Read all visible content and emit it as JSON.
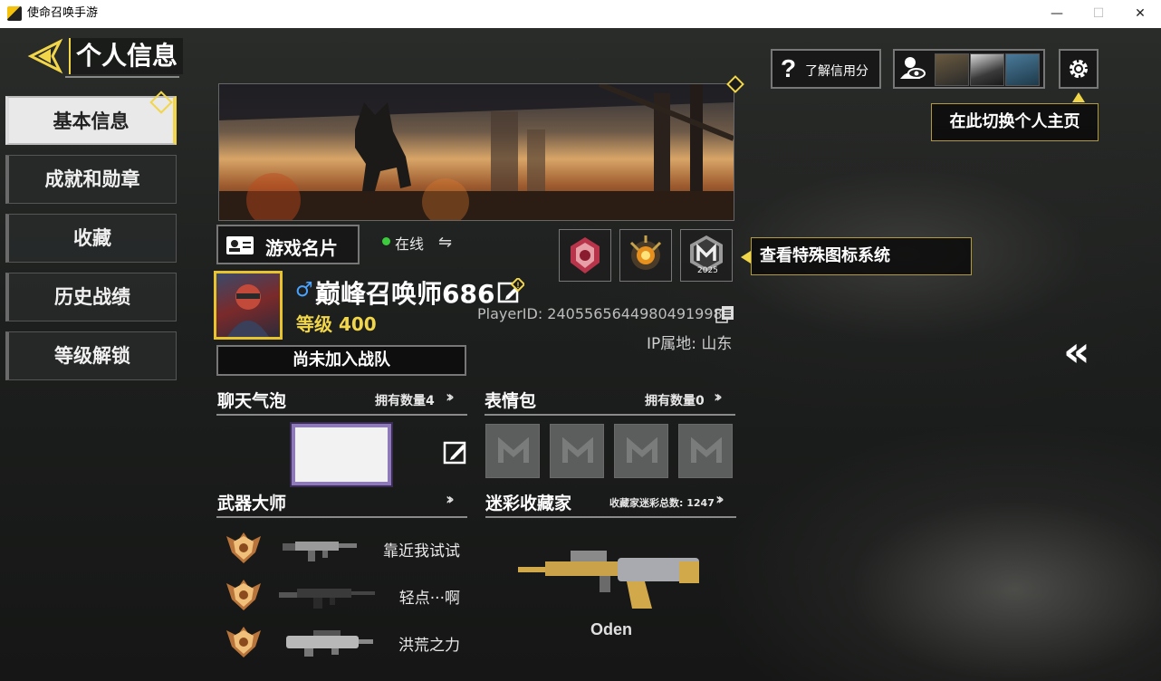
{
  "window": {
    "title": "使命召唤手游",
    "minimize": "—",
    "maximize": "☐",
    "close": "✕"
  },
  "header": {
    "title": "个人信息"
  },
  "nav": {
    "items": [
      {
        "label": "基本信息",
        "active": true
      },
      {
        "label": "成就和勋章",
        "active": false
      },
      {
        "label": "收藏",
        "active": false
      },
      {
        "label": "历史战绩",
        "active": false
      },
      {
        "label": "等级解锁",
        "active": false
      }
    ]
  },
  "top_right": {
    "credit_label": "了解信用分",
    "switch_tip": "在此切换个人主页"
  },
  "card": {
    "button_label": "游戏名片",
    "status": "在线"
  },
  "badges": {
    "tip": "查看特殊图标系统",
    "year_badge": "2025"
  },
  "profile": {
    "name": "巅峰召唤师686",
    "level_label": "等级",
    "level_value": "400",
    "player_id": "PlayerID: 2405565644980491998",
    "ip": "IP属地: 山东",
    "team": "尚未加入战队"
  },
  "sections": {
    "chat_bubble": {
      "title": "聊天气泡",
      "count": "拥有数量4"
    },
    "emotes": {
      "title": "表情包",
      "count": "拥有数量0"
    },
    "weapon_master": {
      "title": "武器大师"
    },
    "camo": {
      "title": "迷彩收藏家",
      "count": "收藏家迷彩总数: 1247"
    }
  },
  "weapons": [
    {
      "name": "靠近我试试"
    },
    {
      "name": "轻点···啊"
    },
    {
      "name": "洪荒之力"
    }
  ],
  "camo_weapon": {
    "name": "Oden"
  },
  "colors": {
    "accent": "#f2d64a",
    "online": "#3ccb3c",
    "gender": "#4aa3ff"
  }
}
